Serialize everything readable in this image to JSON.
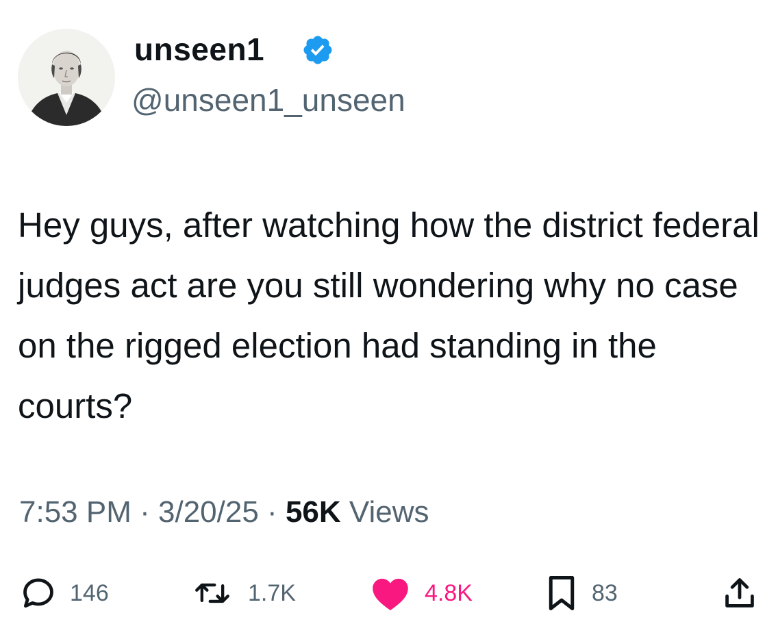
{
  "user": {
    "display_name": "unseen1",
    "handle": "@unseen1_unseen",
    "verified": true,
    "verified_badge_color": "#1d9bf0"
  },
  "tweet": {
    "text": "Hey guys, after watching how the district federal judges act are you still wondering why no case on the rigged election had standing in the courts?",
    "time": "7:53 PM",
    "separator": "·",
    "date": "3/20/25",
    "views_count": "56K",
    "views_label": "Views"
  },
  "actions": {
    "replies": {
      "icon": "reply-icon",
      "count": "146"
    },
    "retweets": {
      "icon": "retweet-icon",
      "count": "1.7K"
    },
    "likes": {
      "icon": "heart-icon",
      "count": "4.8K",
      "liked": true,
      "color": "#f91880"
    },
    "bookmarks": {
      "icon": "bookmark-icon",
      "count": "83"
    },
    "share": {
      "icon": "share-icon"
    }
  },
  "colors": {
    "text_primary": "#0f1419",
    "text_secondary": "#536471",
    "like_active": "#f91880"
  }
}
